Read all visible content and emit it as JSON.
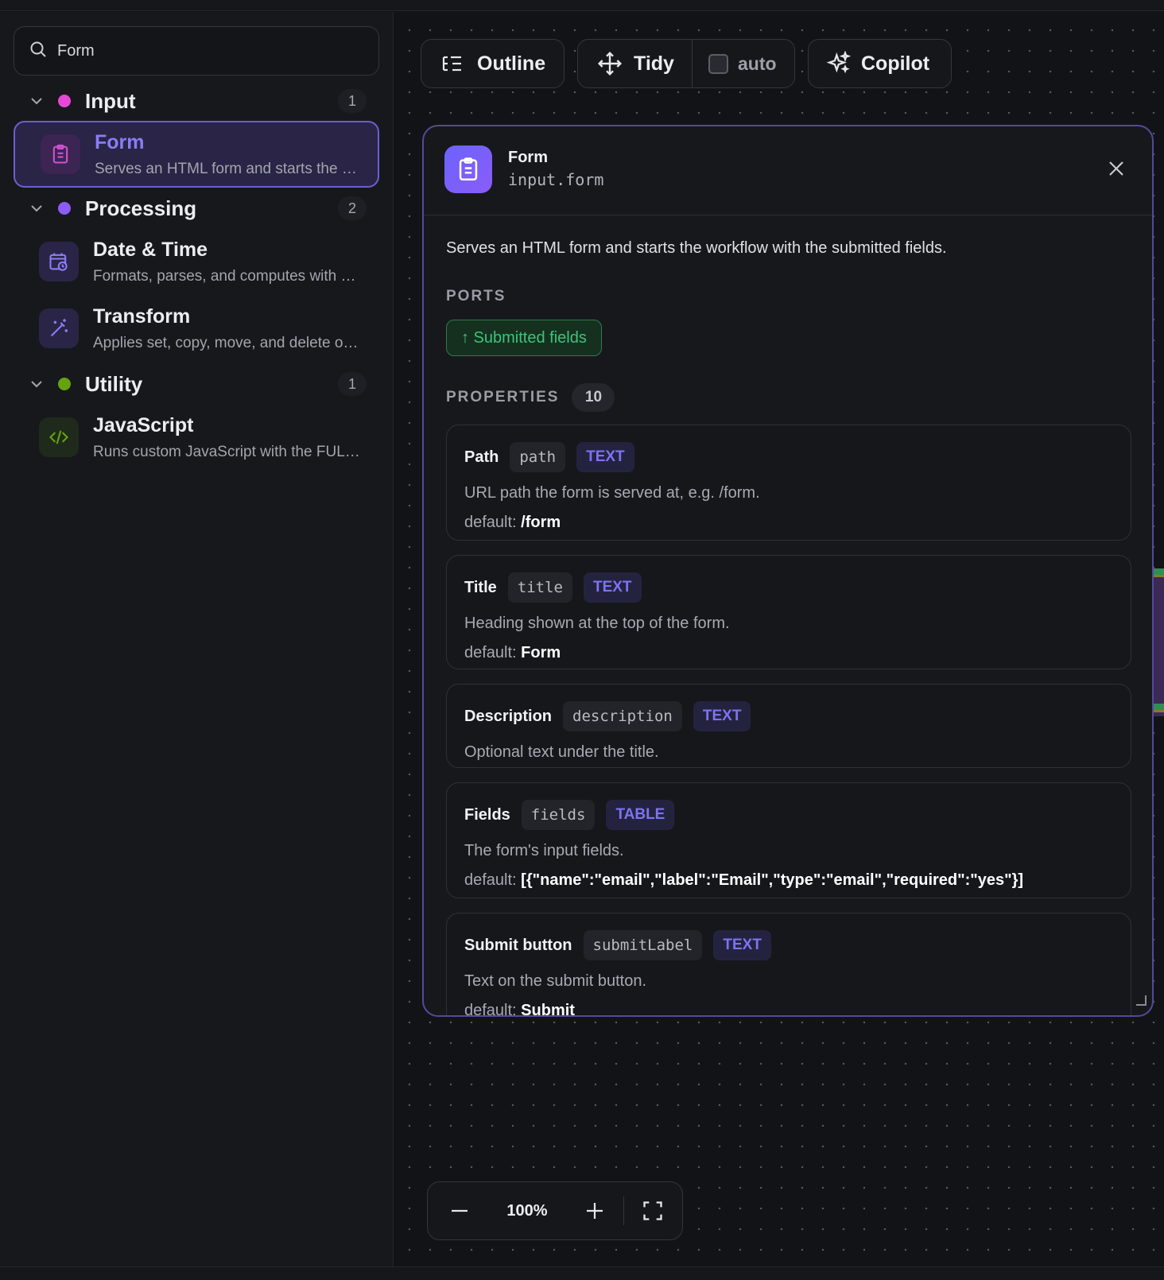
{
  "search": {
    "value": "Form",
    "icon": "search-icon"
  },
  "sidebar": {
    "groups": [
      {
        "label": "Input",
        "count": "1",
        "color": "#e548d8"
      },
      {
        "label": "Processing",
        "count": "2",
        "color": "#8b5cf6"
      },
      {
        "label": "Utility",
        "count": "1",
        "color": "#65a30d"
      }
    ],
    "nodes": [
      {
        "title": "Form",
        "desc": "Serves an HTML form and starts the workflow with the submitted fields.",
        "icon": "clipboard-icon"
      },
      {
        "title": "Date & Time",
        "desc": "Formats, parses, and computes with dates and times.",
        "icon": "calendar-clock-icon"
      },
      {
        "title": "Transform",
        "desc": "Applies set, copy, move, and delete operations to fields.",
        "icon": "magic-wand-icon"
      },
      {
        "title": "JavaScript",
        "desc": "Runs custom JavaScript with the FULL workflow context.",
        "icon": "code-icon"
      }
    ]
  },
  "toolbar": {
    "outline": "Outline",
    "tidy": "Tidy",
    "auto": "auto",
    "copilot": "Copilot"
  },
  "panel": {
    "title": "Form",
    "subtitle": "input.form",
    "description": "Serves an HTML form and starts the workflow with the submitted fields.",
    "ports_heading": "PORTS",
    "port": "↑ Submitted fields",
    "properties_heading": "PROPERTIES",
    "properties_count": "10",
    "default_prefix": "default:",
    "properties": [
      {
        "label": "Path",
        "key": "path",
        "type": "TEXT",
        "desc": "URL path the form is served at, e.g. /form.",
        "default": "/form"
      },
      {
        "label": "Title",
        "key": "title",
        "type": "TEXT",
        "desc": "Heading shown at the top of the form.",
        "default": "Form"
      },
      {
        "label": "Description",
        "key": "description",
        "type": "TEXT",
        "desc": "Optional text under the title."
      },
      {
        "label": "Fields",
        "key": "fields",
        "type": "TABLE",
        "desc": "The form's input fields.",
        "default": "[{\"name\":\"email\",\"label\":\"Email\",\"type\":\"email\",\"required\":\"yes\"}]"
      },
      {
        "label": "Submit button",
        "key": "submitLabel",
        "type": "TEXT",
        "desc": "Text on the submit button.",
        "default": "Submit"
      }
    ]
  },
  "zoom": {
    "level": "100%"
  },
  "colors": {
    "accent": "#8b7cf6",
    "port_green": "#3cc47a",
    "type_purple": "#7d73f2"
  }
}
